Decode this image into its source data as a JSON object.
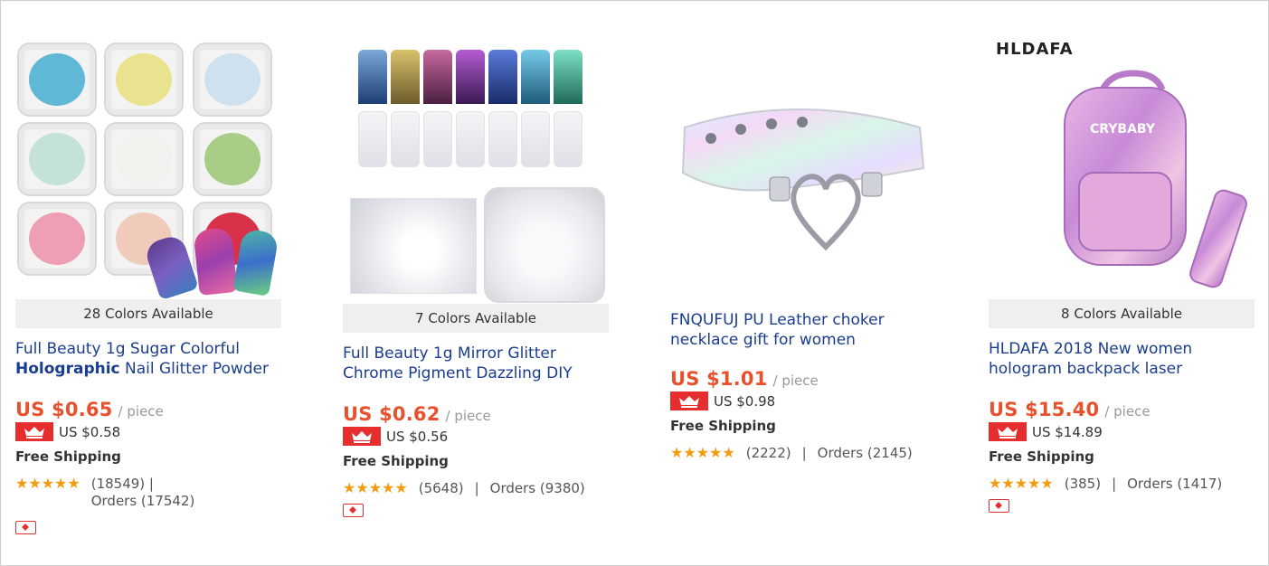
{
  "products": [
    {
      "colors": "28 Colors Available",
      "title_pre": "Full Beauty 1g Sugar Colorful ",
      "title_bold": "Holographic",
      "title_post": " Nail Glitter Powder",
      "price": "US $0.65",
      "unit": "/ piece",
      "app_price": "US $0.58",
      "shipping": "Free Shipping",
      "reviews": "(18549)",
      "sep": "|",
      "orders": "Orders (17542)"
    },
    {
      "colors": "7 Colors Available",
      "title_line1": "Full Beauty 1g Mirror Glitter",
      "title_line2": "Chrome Pigment Dazzling DIY",
      "price": "US $0.62",
      "unit": "/ piece",
      "app_price": "US $0.56",
      "shipping": "Free Shipping",
      "reviews": "(5648)",
      "sep": "|",
      "orders": "Orders (9380)"
    },
    {
      "title_line1": "FNQUFUJ PU Leather choker",
      "title_line2": "necklace gift for women",
      "price": "US $1.01",
      "unit": "/ piece",
      "app_price": "US $0.98",
      "shipping": "Free Shipping",
      "reviews": "(2222)",
      "sep": "|",
      "orders": "Orders (2145)"
    },
    {
      "brand": "HLDAFA",
      "bag_text": "CRYBABY",
      "colors": "8 Colors Available",
      "title_line1": "HLDAFA 2018 New women",
      "title_line2": "hologram backpack laser",
      "price": "US $15.40",
      "unit": "/ piece",
      "app_price": "US $14.89",
      "shipping": "Free Shipping",
      "reviews": "(385)",
      "sep": "|",
      "orders": "Orders (1417)"
    }
  ],
  "rating_stars": "★★★★★",
  "colors_theme": {
    "price": "#e8512e",
    "title": "#1a3d8f",
    "badge": "#e62e2e",
    "star": "#f39c12"
  }
}
